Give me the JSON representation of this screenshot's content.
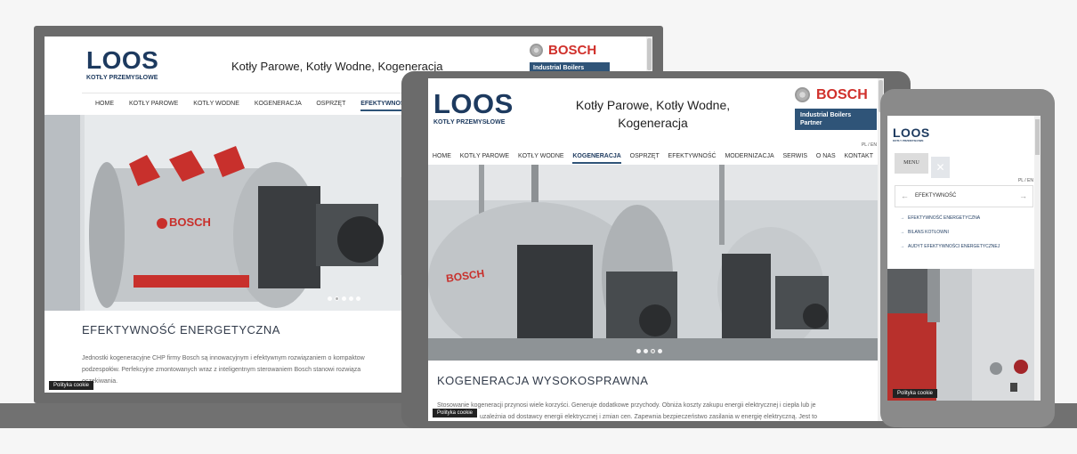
{
  "brand": {
    "logo": "LOOS",
    "logo_sub": "KOTŁY PRZEMYSŁOWE",
    "bosch": "BOSCH",
    "partner_laptop": "Industrial Boilers",
    "partner_tablet_1": "Industrial Boilers",
    "partner_tablet_2": "Partner",
    "boiler_label": "BOSCH"
  },
  "colors": {
    "navy": "#1d3a5f",
    "bosch_red": "#d0302b",
    "partner_blue": "#2f5478"
  },
  "laptop": {
    "tagline": "Kotły Parowe, Kotły Wodne, Kogeneracja",
    "nav": [
      "HOME",
      "KOTŁY PAROWE",
      "KOTŁY WODNE",
      "KOGENERACJA",
      "OSPRZĘT",
      "EFEKTYWNOŚ"
    ],
    "section_title": "EFEKTYWNOŚĆ ENERGETYCZNA",
    "body_1": "Jednostki kogeneracyjne CHP firmy Bosch są innowacyjnym i efektywnym rozwiązaniem o kompaktow",
    "body_2": "podzespołów. Perfekcyjne zmontowanych wraz z inteligentnym sterowaniem Bosch stanowi rozwiąza",
    "body_3": "oczekiwania.",
    "cookie": "Polityka cookie"
  },
  "tablet": {
    "tagline": "Kotły Parowe, Kotły Wodne, Kogeneracja",
    "lang": "PL / EN",
    "nav": [
      "HOME",
      "KOTŁY PAROWE",
      "KOTŁY WODNE",
      "KOGENERACJA",
      "OSPRZĘT",
      "EFEKTYWNOŚĆ",
      "MODERNIZACJA",
      "SERWIS",
      "O NAS",
      "KONTAKT"
    ],
    "section_title": "KOGENERACJA WYSOKOSPRAWNA",
    "body_1": "Stosowanie kogeneracji przynosi wiele korzyści. Generuje dodatkowe przychody. Obniża koszty zakupu energii elektrycznej i ciepła lub je",
    "body_2": "uzależnia od dostawcy energii elektrycznej i zmian cen. Zapewnia bezpieczeństwo zasilania w energię elektryczną. Jest to",
    "cookie": "Polityka cookie"
  },
  "phone": {
    "menu": "MENU",
    "close": "✕",
    "lang": "PL / EN",
    "subhead": "EFEKTYWNOŚĆ",
    "links": [
      "EFEKTYWNOŚĆ ENERGETYCZNA",
      "BILANS KOTŁOWNI",
      "AUDYT EFEKTYWNOŚCI ENERGETYCZNEJ"
    ],
    "cookie": "Polityka cookie"
  },
  "icons": [
    "bosch-logo-icon",
    "arrow-left-icon",
    "arrow-right-icon",
    "close-icon",
    "bullet-arrow-icon"
  ]
}
